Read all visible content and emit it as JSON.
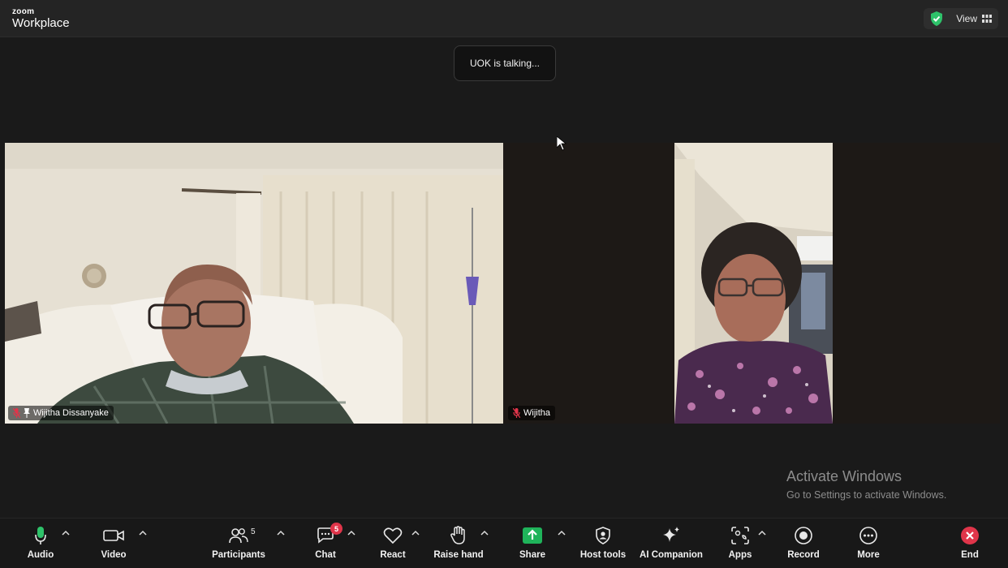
{
  "titlebar": {
    "brand_top": "zoom",
    "brand_main": "Workplace",
    "view_label": "View",
    "security_icon": "green-shield-check-icon",
    "accent_color": "#2ec26a"
  },
  "toast": {
    "text": "UOK is talking..."
  },
  "participants": [
    {
      "name": "Wijitha Dissanyake",
      "muted": true
    },
    {
      "name": "Wijitha",
      "muted": true
    }
  ],
  "watermark": {
    "title": "Activate Windows",
    "subtitle": "Go to Settings to activate Windows."
  },
  "toolbar": {
    "audio": "Audio",
    "video": "Video",
    "participants": "Participants",
    "participants_count": "5",
    "chat": "Chat",
    "chat_badge": "5",
    "react": "React",
    "raise_hand": "Raise hand",
    "share": "Share",
    "host_tools": "Host tools",
    "ai_companion": "AI Companion",
    "apps": "Apps",
    "record": "Record",
    "more": "More",
    "end": "End",
    "share_color": "#1fb35a",
    "end_color": "#e0354a",
    "mic_color": "#2ec26a"
  }
}
